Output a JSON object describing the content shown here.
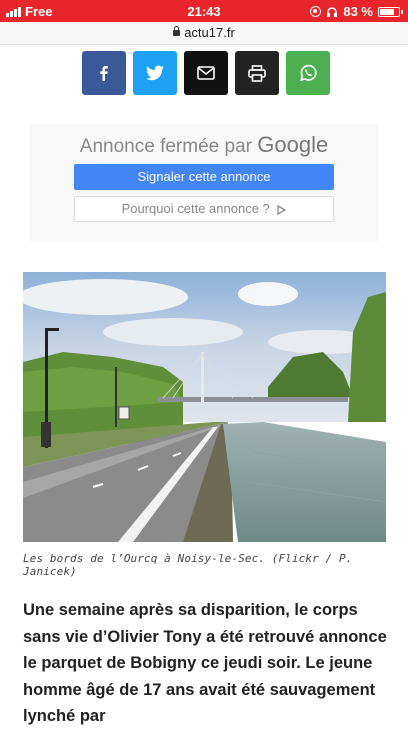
{
  "status_bar": {
    "carrier": "Free",
    "time": "21:43",
    "battery_percent": "83 %",
    "battery_level": 0.83
  },
  "url_bar": {
    "domain": "actu17.fr"
  },
  "share": {
    "buttons": [
      {
        "name": "facebook",
        "color": "#3b5998",
        "icon": "facebook-icon"
      },
      {
        "name": "twitter",
        "color": "#1da1f2",
        "icon": "twitter-icon"
      },
      {
        "name": "email",
        "color": "#111111",
        "icon": "mail-icon"
      },
      {
        "name": "print",
        "color": "#222222",
        "icon": "printer-icon"
      },
      {
        "name": "whatsapp",
        "color": "#4caf50",
        "icon": "whatsapp-icon"
      }
    ]
  },
  "ad": {
    "title_prefix": "Annonce fermée par",
    "title_brand": "Google",
    "report_label": "Signaler cette annonce",
    "why_label": "Pourquoi cette annonce ?",
    "report_color": "#4285f4"
  },
  "article": {
    "caption": "Les bords de l’Ourcq à Noisy-le-Sec. (Flickr / P. Janicek)",
    "body": "Une semaine après sa disparition, le corps sans vie d’Olivier Tony a été retrouvé annonce le parquet de Bobigny ce jeudi soir. Le jeune homme âgé de 17 ans avait été sauvagement lynché par"
  },
  "colors": {
    "status_bar": "#e8252a"
  }
}
